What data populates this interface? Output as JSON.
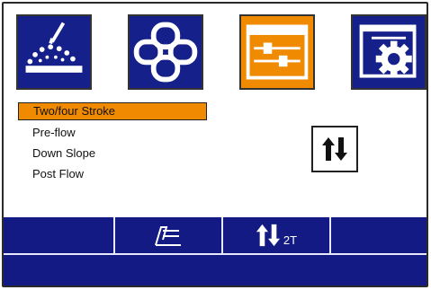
{
  "colors": {
    "tab_blue": "#15208a",
    "tab_orange": "#f08a00",
    "selection": "#f08a00",
    "bar_blue": "#141a84"
  },
  "tabs": [
    {
      "icon": "welding-arc-icon",
      "selected": false
    },
    {
      "icon": "chain-link-icon",
      "selected": false
    },
    {
      "icon": "sliders-settings-icon",
      "selected": true
    },
    {
      "icon": "window-gear-icon",
      "selected": false
    }
  ],
  "menu": {
    "items": [
      {
        "label": "Two/four Stroke",
        "selected": true
      },
      {
        "label": "Pre-flow",
        "selected": false
      },
      {
        "label": "Down Slope",
        "selected": false
      },
      {
        "label": "Post  Flow",
        "selected": false
      }
    ]
  },
  "action": {
    "icon": "up-down-arrows-icon"
  },
  "status": {
    "mode": "2T",
    "process_icon": "torch-lines-icon",
    "stroke_icon": "up-down-arrows-icon"
  }
}
